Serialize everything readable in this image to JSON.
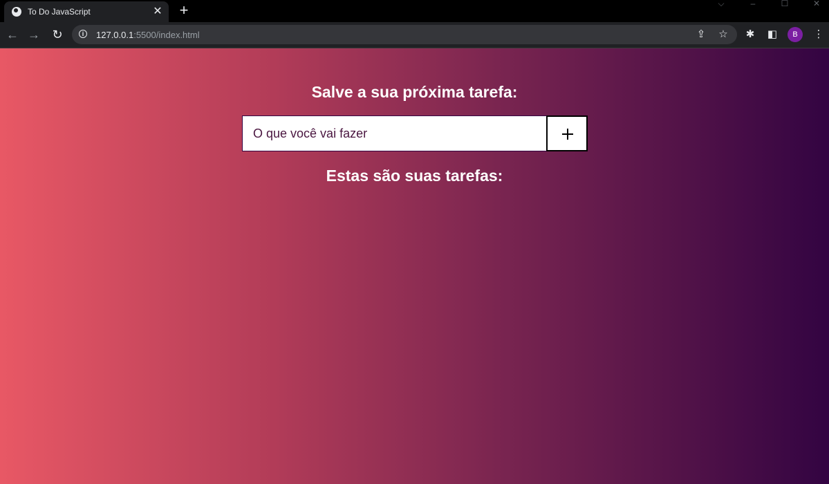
{
  "browser": {
    "tab_title": "To Do JavaScript",
    "new_tab_label": "+",
    "url_host": "127.0.0.1",
    "url_rest": ":5500/index.html",
    "profile_initial": "B"
  },
  "app": {
    "save_heading": "Salve a sua próxima tarefa:",
    "input_placeholder": "O que você vai fazer",
    "input_value": "",
    "list_heading": "Estas são suas tarefas:"
  },
  "colors": {
    "gradient_start": "#e85865",
    "gradient_end": "#330442",
    "heading_text": "#ffffff"
  }
}
